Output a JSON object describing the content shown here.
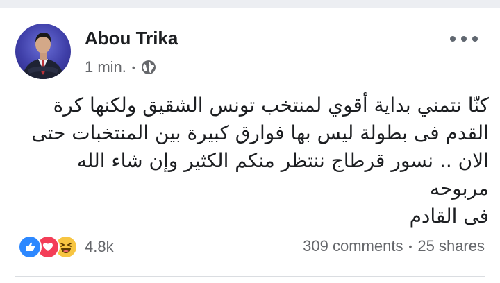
{
  "post": {
    "author": "Abou Trika",
    "time": "1 min.",
    "separator": "•",
    "privacy_icon": "globe-icon",
    "more_icon": "more-options-icon",
    "text_lines": [
      "كنّا نتمني بداية أقوي لمنتخب تونس الشقيق ولكنها كرة",
      "القدم فى بطولة ليس بها فوارق كبيرة بين المنتخبات حتى",
      "الان .. نسور قرطاج ننتظر منكم الكثير وإن شاء الله مربوحه",
      "فى القادم"
    ]
  },
  "footer": {
    "reaction_icons": [
      "like-icon",
      "love-icon",
      "haha-icon"
    ],
    "reaction_count": "4.8k",
    "comments": "309 comments",
    "dot": "•",
    "shares": "25 shares"
  },
  "colors": {
    "like": "#2d88ff",
    "love": "#f33e58",
    "haha": "#f7c542",
    "secondary_text": "#65676b"
  }
}
